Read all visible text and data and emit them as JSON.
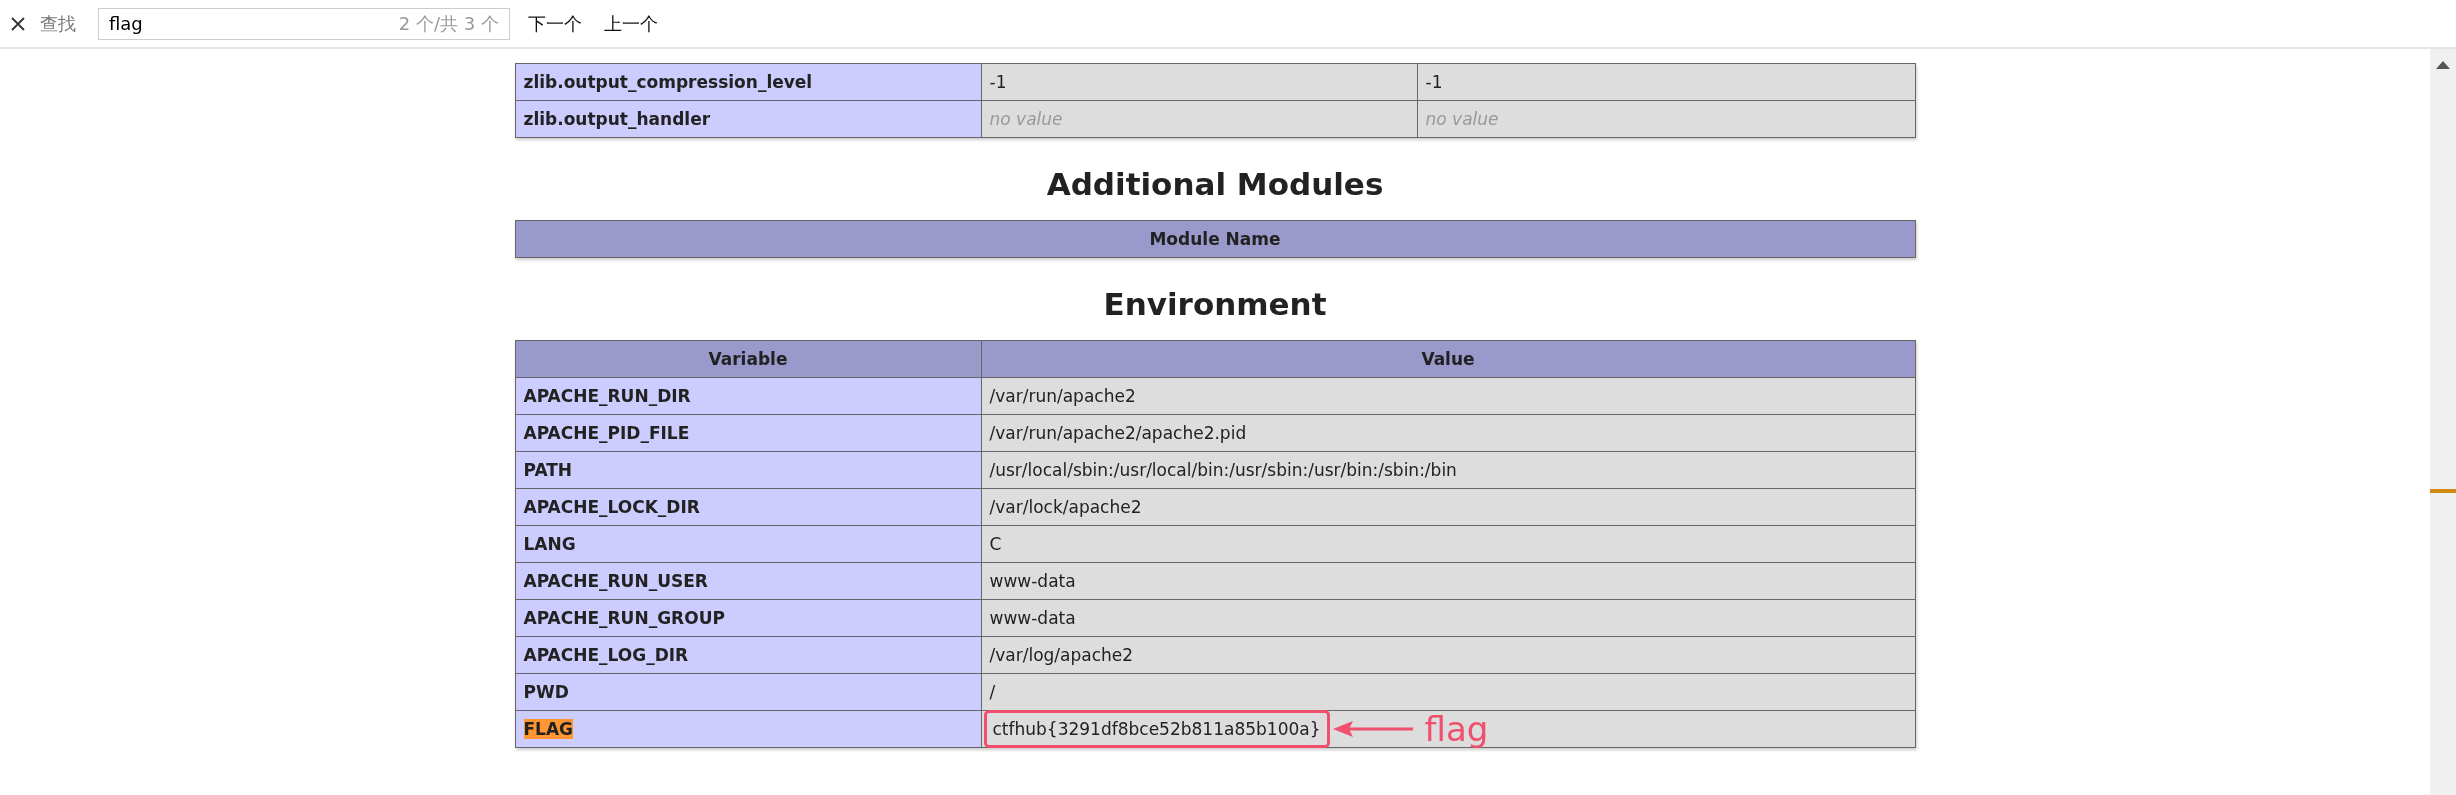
{
  "find_bar": {
    "label": "查找",
    "query": "flag",
    "match_count": "2 个/共 3 个",
    "buttons": [
      "下一个",
      "上一个"
    ]
  },
  "config_table": {
    "rows": [
      {
        "name": "zlib.output_compression_level",
        "local": "-1",
        "master": "-1",
        "no_value": false
      },
      {
        "name": "zlib.output_handler",
        "local": "no value",
        "master": "no value",
        "no_value": true
      }
    ]
  },
  "sections": [
    {
      "heading": "Additional Modules",
      "columns": [
        "Module Name"
      ]
    },
    {
      "heading": "Environment",
      "columns": [
        "Variable",
        "Value"
      ],
      "rows": [
        {
          "name": "APACHE_RUN_DIR",
          "value": "/var/run/apache2",
          "highlighted": false,
          "boxed": false
        },
        {
          "name": "APACHE_PID_FILE",
          "value": "/var/run/apache2/apache2.pid",
          "highlighted": false,
          "boxed": false
        },
        {
          "name": "PATH",
          "value": "/usr/local/sbin:/usr/local/bin:/usr/sbin:/usr/bin:/sbin:/bin",
          "highlighted": false,
          "boxed": false
        },
        {
          "name": "APACHE_LOCK_DIR",
          "value": "/var/lock/apache2",
          "highlighted": false,
          "boxed": false
        },
        {
          "name": "LANG",
          "value": "C",
          "highlighted": false,
          "boxed": false
        },
        {
          "name": "APACHE_RUN_USER",
          "value": "www-data",
          "highlighted": false,
          "boxed": false
        },
        {
          "name": "APACHE_RUN_GROUP",
          "value": "www-data",
          "highlighted": false,
          "boxed": false
        },
        {
          "name": "APACHE_LOG_DIR",
          "value": "/var/log/apache2",
          "highlighted": false,
          "boxed": false
        },
        {
          "name": "PWD",
          "value": "/",
          "highlighted": false,
          "boxed": false
        },
        {
          "name": "FLAG",
          "value": "ctfhub{3291df8bce52b811a85b100a}",
          "highlighted": true,
          "boxed": true
        }
      ]
    }
  ],
  "annotation": {
    "text": "flag"
  }
}
